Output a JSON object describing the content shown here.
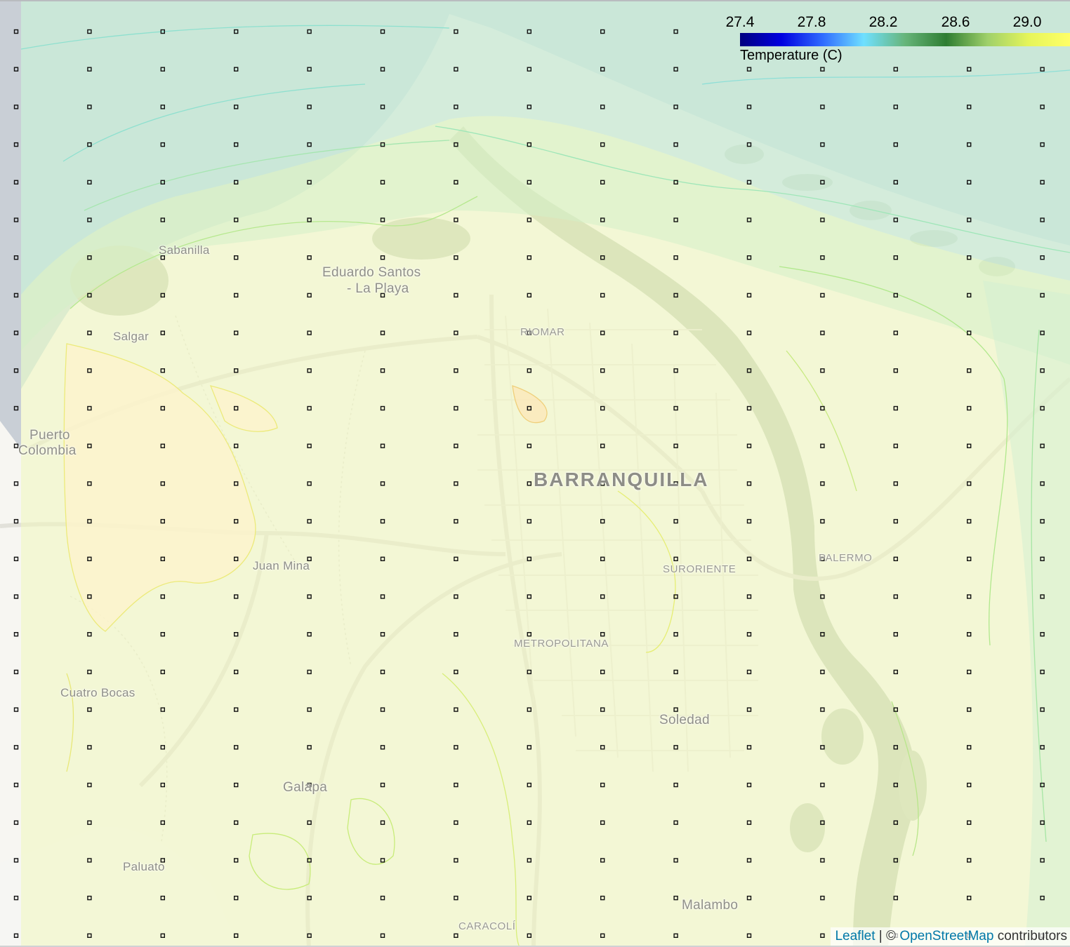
{
  "map": {
    "places": [
      {
        "id": "sabanilla",
        "label": "Sabanilla",
        "kind": "town"
      },
      {
        "id": "eduardo-santos-1",
        "label": "Eduardo Santos",
        "kind": "city"
      },
      {
        "id": "eduardo-santos-2",
        "label": "- La Playa",
        "kind": "city"
      },
      {
        "id": "salgar",
        "label": "Salgar",
        "kind": "town"
      },
      {
        "id": "riomar",
        "label": "RIOMAR",
        "kind": "hood"
      },
      {
        "id": "puerto-colombia-1",
        "label": "Puerto",
        "kind": "city"
      },
      {
        "id": "puerto-colombia-2",
        "label": "Colombia",
        "kind": "city"
      },
      {
        "id": "barranquilla",
        "label": "BARRANQUILLA",
        "kind": "big"
      },
      {
        "id": "juan-mina",
        "label": "Juan Mina",
        "kind": "town"
      },
      {
        "id": "suroriente",
        "label": "SURORIENTE",
        "kind": "hood"
      },
      {
        "id": "palermo",
        "label": "PALERMO",
        "kind": "hood"
      },
      {
        "id": "metropolitana",
        "label": "METROPOLITANA",
        "kind": "hood"
      },
      {
        "id": "cuatro-bocas",
        "label": "Cuatro Bocas",
        "kind": "town"
      },
      {
        "id": "soledad",
        "label": "Soledad",
        "kind": "city"
      },
      {
        "id": "galapa",
        "label": "Galapa",
        "kind": "city"
      },
      {
        "id": "paluato",
        "label": "Paluato",
        "kind": "town"
      },
      {
        "id": "caracoli",
        "label": "CARACOLÍ",
        "kind": "hood"
      },
      {
        "id": "malambo",
        "label": "Malambo",
        "kind": "city"
      }
    ]
  },
  "legend": {
    "title": "Temperature (C)",
    "ticks": [
      "27.4",
      "27.8",
      "28.2",
      "28.6",
      "29.0"
    ],
    "colormap": [
      "#00007f",
      "#0000e0",
      "#2f6bff",
      "#6fe0ff",
      "#67b57a",
      "#2e7d32",
      "#9fd06a",
      "#e6f55a",
      "#ffff66"
    ]
  },
  "attribution": {
    "leaflet": "Leaflet",
    "separator": " | © ",
    "osm": "OpenStreetMap",
    "suffix": " contributors"
  },
  "overlay_colors": {
    "sea": "#bfe1e6",
    "coast": "#cdeedd",
    "land": "#f3f7c4",
    "warm": "#fdf5cf",
    "river": "#bcd0b2"
  }
}
